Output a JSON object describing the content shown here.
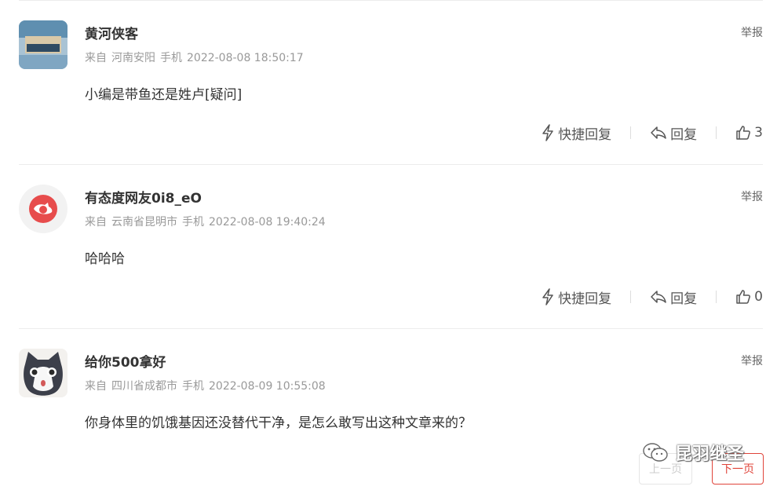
{
  "comments": [
    {
      "username": "黄河侠客",
      "source_prefix": "来自",
      "location": "河南安阳",
      "device": "手机",
      "timestamp": "2022-08-08 18:50:17",
      "report": "举报",
      "content": "小编是带鱼还是姓卢[疑问]",
      "quick_reply": "快捷回复",
      "reply": "回复",
      "likes": "3"
    },
    {
      "username": "有态度网友0i8_eO",
      "source_prefix": "来自",
      "location": "云南省昆明市",
      "device": "手机",
      "timestamp": "2022-08-08 19:40:24",
      "report": "举报",
      "content": "哈哈哈",
      "quick_reply": "快捷回复",
      "reply": "回复",
      "likes": "0"
    },
    {
      "username": "给你500拿好",
      "source_prefix": "来自",
      "location": "四川省成都市",
      "device": "手机",
      "timestamp": "2022-08-09 10:55:08",
      "report": "举报",
      "content": "你身体里的饥饿基因还没替代干净，是怎么敢写出这种文章来的？"
    }
  ],
  "pager": {
    "prev": "上一页",
    "next": "下一页"
  },
  "watermark": {
    "text": "昆羽继圣",
    "icon": "wechat-icon"
  },
  "colors": {
    "accent": "#e0443a",
    "meta": "#999999",
    "divider": "#ececec"
  }
}
